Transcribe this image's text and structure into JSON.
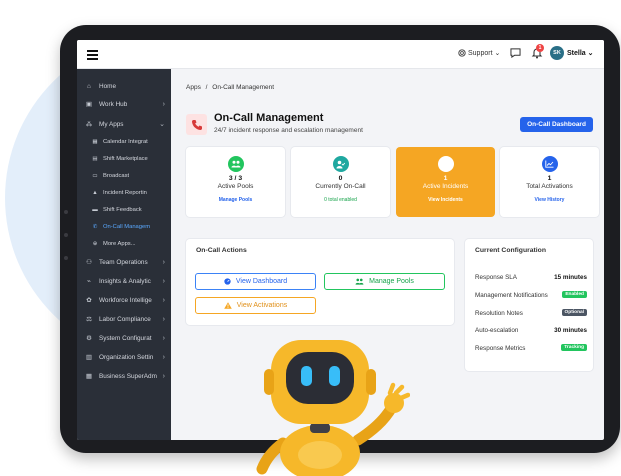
{
  "topbar": {
    "support_label": "Support",
    "notif_count": "1",
    "avatar_initials": "SK",
    "username": "Stella"
  },
  "sidebar": {
    "items": [
      {
        "label": "Home",
        "icon": "home-icon"
      },
      {
        "label": "Work Hub",
        "icon": "briefcase-icon"
      },
      {
        "label": "My Apps",
        "icon": "apps-icon"
      },
      {
        "label": "Calendar Integrat",
        "icon": "calendar-icon"
      },
      {
        "label": "Shift Marketplace",
        "icon": "store-icon"
      },
      {
        "label": "Broadcast",
        "icon": "broadcast-icon"
      },
      {
        "label": "Incident Reportin",
        "icon": "warning-icon"
      },
      {
        "label": "Shift Feedback",
        "icon": "comment-icon"
      },
      {
        "label": "On-Call Managem",
        "icon": "phone-icon"
      },
      {
        "label": "More Apps...",
        "icon": "plus-icon"
      },
      {
        "label": "Team Operations",
        "icon": "team-icon"
      },
      {
        "label": "Insights & Analytic",
        "icon": "chart-icon"
      },
      {
        "label": "Workforce Intellige",
        "icon": "brain-icon"
      },
      {
        "label": "Labor Compliance",
        "icon": "scale-icon"
      },
      {
        "label": "System Configurat",
        "icon": "gear-icon"
      },
      {
        "label": "Organization Settin",
        "icon": "building-icon"
      },
      {
        "label": "Business SuperAdm",
        "icon": "grid-icon"
      }
    ]
  },
  "breadcrumb": {
    "root": "Apps",
    "sep": "/",
    "current": "On-Call Management"
  },
  "header": {
    "title": "On-Call Management",
    "subtitle": "24/7 incident response and escalation management",
    "action_label": "On-Call Dashboard"
  },
  "cards": [
    {
      "value": "3 / 3",
      "label": "Active Pools",
      "link": "Manage Pools"
    },
    {
      "value": "0",
      "label": "Currently On-Call",
      "link": "0 total enabled"
    },
    {
      "value": "1",
      "label": "Active Incidents",
      "link": "View Incidents"
    },
    {
      "value": "1",
      "label": "Total Activations",
      "link": "View History"
    }
  ],
  "actions": {
    "title": "On-Call Actions",
    "view_dashboard": "View Dashboard",
    "manage_pools": "Manage Pools",
    "view_activations": "View Activations"
  },
  "config": {
    "title": "Current Configuration",
    "rows": [
      {
        "label": "Response SLA",
        "value": "15 minutes"
      },
      {
        "label": "Management Notifications",
        "value": "Enabled"
      },
      {
        "label": "Resolution Notes",
        "value": "Optional"
      },
      {
        "label": "Auto-escalation",
        "value": "30 minutes"
      },
      {
        "label": "Response Metrics",
        "value": "Tracking"
      }
    ]
  },
  "colors": {
    "accent": "#2563eb",
    "sidebar": "#2a2f38",
    "incident_card": "#f5a623",
    "success": "#22c55e"
  }
}
